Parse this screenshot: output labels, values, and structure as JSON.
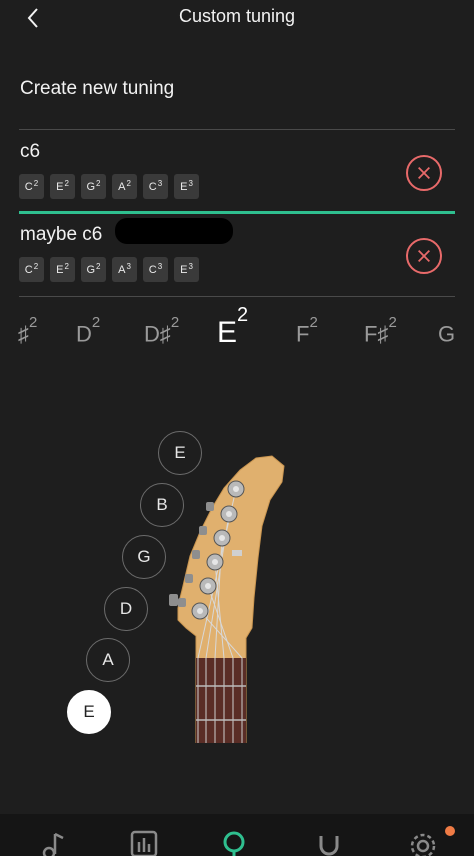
{
  "header": {
    "title": "Custom tuning",
    "back_icon": "chevron-left-icon"
  },
  "create_label": "Create new tuning",
  "tunings": [
    {
      "name": "c6",
      "notes": [
        {
          "n": "C",
          "o": "2"
        },
        {
          "n": "E",
          "o": "2"
        },
        {
          "n": "G",
          "o": "2"
        },
        {
          "n": "A",
          "o": "2"
        },
        {
          "n": "C",
          "o": "3"
        },
        {
          "n": "E",
          "o": "3"
        }
      ]
    },
    {
      "name": "maybe c6",
      "notes": [
        {
          "n": "C",
          "o": "2"
        },
        {
          "n": "E",
          "o": "2"
        },
        {
          "n": "G",
          "o": "2"
        },
        {
          "n": "A",
          "o": "3"
        },
        {
          "n": "C",
          "o": "3"
        },
        {
          "n": "E",
          "o": "3"
        }
      ]
    }
  ],
  "picker": {
    "notes": [
      {
        "n": "♯",
        "o": "2"
      },
      {
        "n": "D",
        "o": "2"
      },
      {
        "n": "D♯",
        "o": "2"
      },
      {
        "n": "E",
        "o": "2"
      },
      {
        "n": "F",
        "o": "2"
      },
      {
        "n": "F♯",
        "o": "2"
      },
      {
        "n": "G",
        "o": ""
      }
    ],
    "selected_index": 3
  },
  "strings": [
    "E",
    "B",
    "G",
    "D",
    "A",
    "E"
  ],
  "selected_string_index": 5,
  "tabs": [
    "music-note-icon",
    "chart-icon",
    "tuner-icon",
    "magnet-icon",
    "gear-icon"
  ],
  "colors": {
    "background": "#1e1e1e",
    "accent": "#2fbf8f",
    "delete": "#e86a6a",
    "notification": "#ef7b45"
  }
}
